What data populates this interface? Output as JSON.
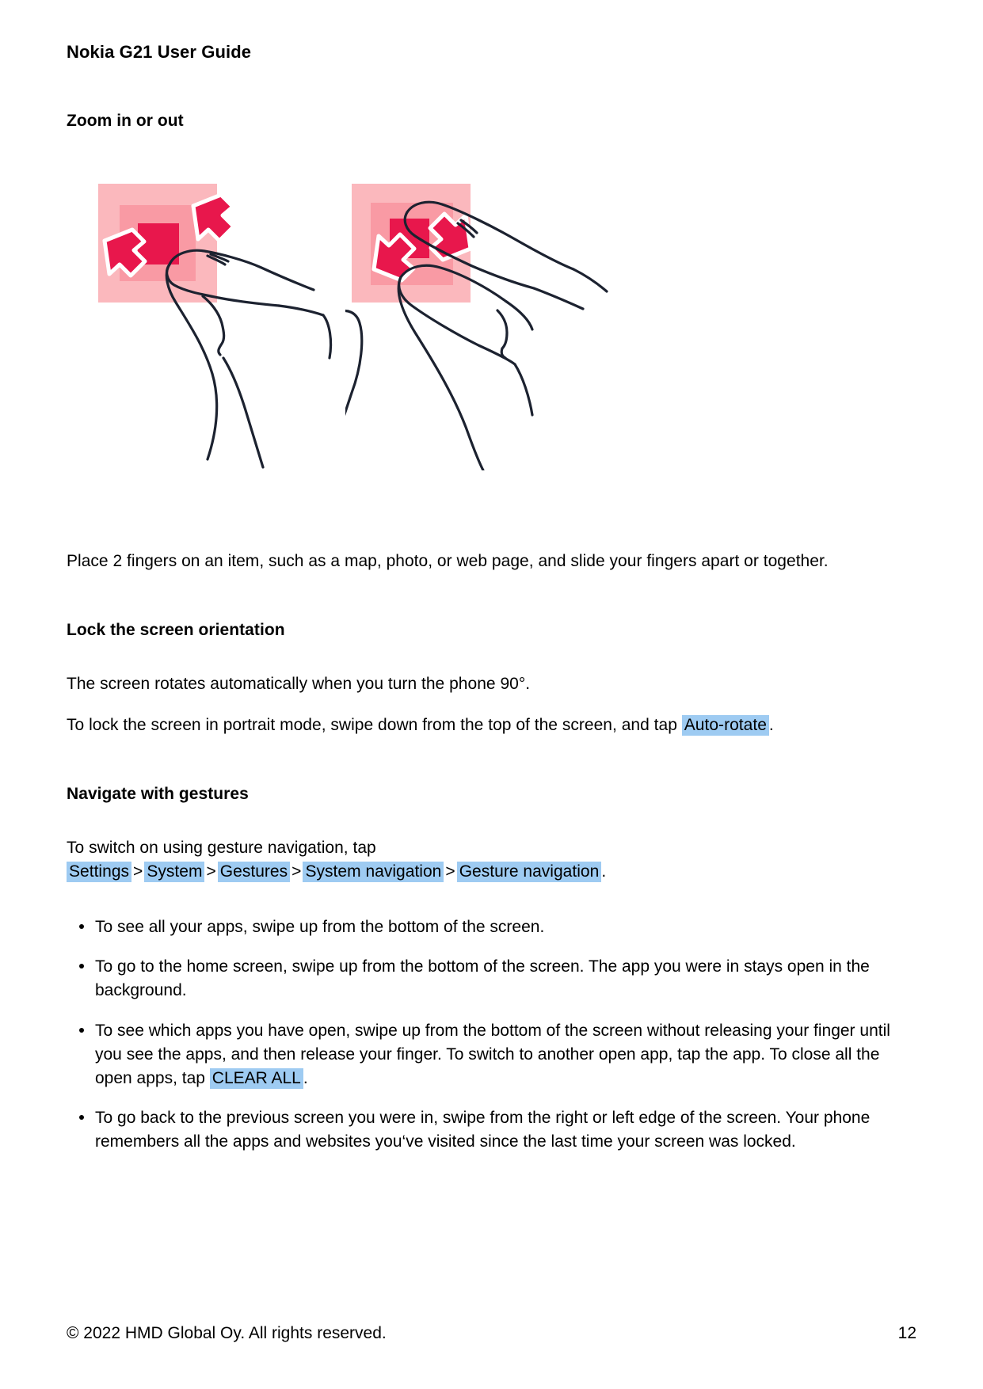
{
  "document": {
    "header": "Nokia G21 User Guide",
    "footer_copyright": "© 2022 HMD Global Oy. All rights reserved.",
    "page_number": "12"
  },
  "sections": {
    "zoom": {
      "heading": "Zoom in or out",
      "body": "Place 2 fingers on an item, such as a map, photo, or web page, and slide your fingers apart or together.",
      "illustration_left_name": "pinch-in-gesture-illustration",
      "illustration_right_name": "pinch-out-gesture-illustration"
    },
    "lock_orientation": {
      "heading": "Lock the screen orientation",
      "paragraph1": "The screen rotates automatically when you turn the phone 90°.",
      "paragraph2_before": "To lock the screen in portrait mode, swipe down from the top of the screen, and tap",
      "paragraph2_highlight": "Auto-rotate",
      "paragraph2_after": "."
    },
    "gestures": {
      "heading": "Navigate with gestures",
      "intro_before": "To switch on using gesture navigation, tap",
      "path": [
        "Settings",
        "System",
        "Gestures",
        "System navigation",
        "Gesture navigation"
      ],
      "path_separator": ">",
      "intro_after": ".",
      "bullets": [
        {
          "text": "To see all your apps, swipe up from the bottom of the screen."
        },
        {
          "text": "To go to the home screen, swipe up from the bottom of the screen.  The app you were in stays open in the background."
        },
        {
          "text_before": "To see which apps you have open, swipe up from the bottom of the screen without releasing your finger until you see the apps, and then release your finger.  To switch to another open app, tap the app.  To close all the open apps, tap",
          "highlight": "CLEAR ALL",
          "text_after": "."
        },
        {
          "text": "To go back to the previous screen you were in, swipe from the right or left edge of the screen.  Your phone remembers all the apps and websites you‘ve visited since the last time your screen was locked."
        }
      ]
    }
  },
  "colors": {
    "highlight": "#9ecbf2",
    "illustration_square_outer": "#fbb8bd",
    "illustration_square_mid": "#f99aa4",
    "illustration_square_inner": "#e8174c",
    "illustration_arrow": "#e8174c",
    "illustration_outline": "#1c2230",
    "text": "#000000"
  }
}
